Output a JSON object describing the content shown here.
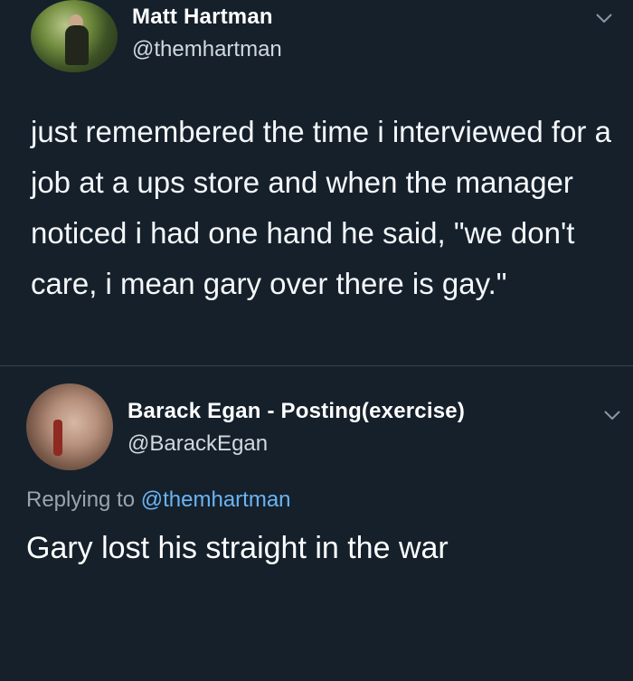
{
  "original_tweet": {
    "author_name": "Matt Hartman",
    "author_handle": "@themhartman",
    "text": "just remembered the time i interviewed for a job at a ups store and when the manager noticed i had one hand he said, \"we don't care, i mean gary over there is gay.\"",
    "menu_icon": "chevron-down-icon"
  },
  "reply_tweet": {
    "author_name": "Barack Egan - Posting(exercise)",
    "author_handle": "@BarackEgan",
    "replying_prefix": "Replying to",
    "replying_to": "@themhartman",
    "text": "Gary lost his straight in the war",
    "menu_icon": "chevron-down-icon"
  },
  "colors": {
    "background": "#15202b",
    "text_primary": "#ffffff",
    "text_secondary": "#9aa4ad",
    "link": "#6bb4f3",
    "divider": "#38444d"
  }
}
